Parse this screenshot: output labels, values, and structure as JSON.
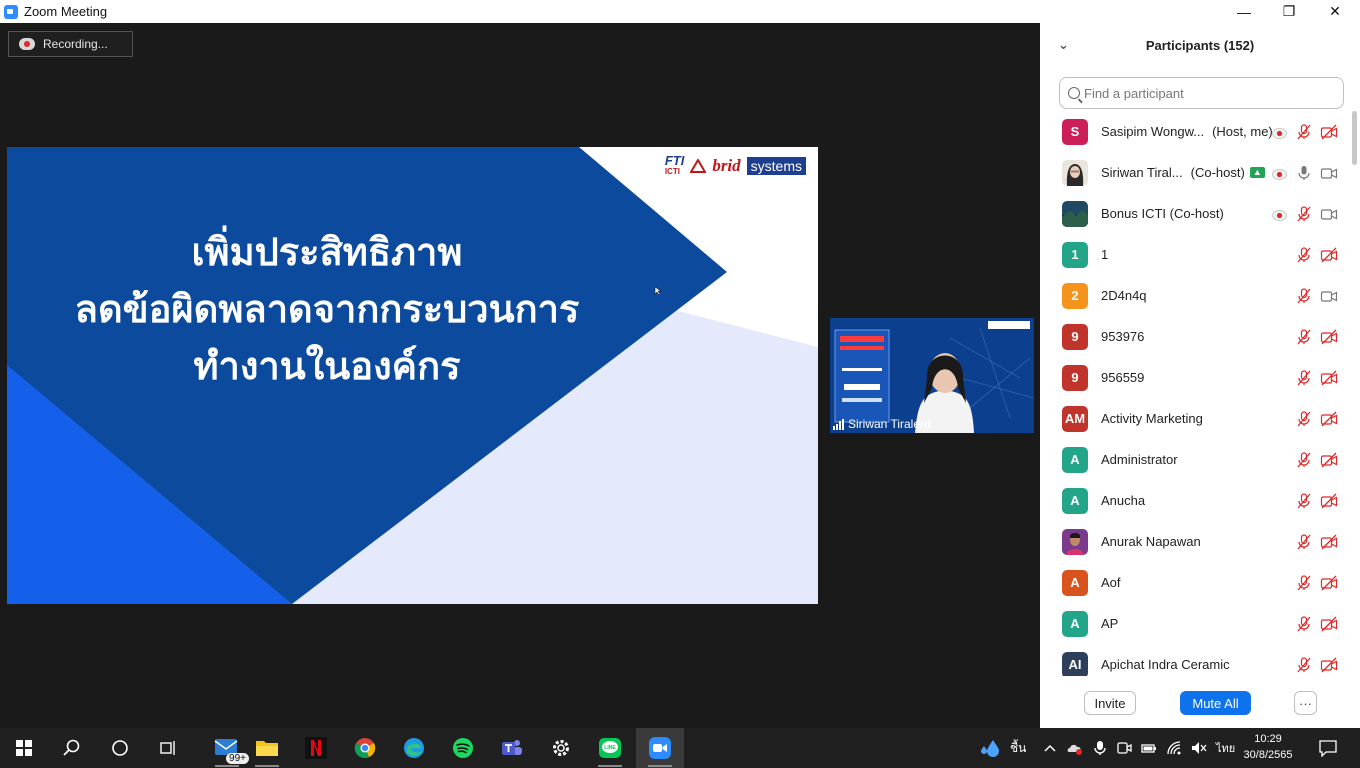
{
  "window": {
    "title": "Zoom Meeting",
    "minimize": "—",
    "maximize": "❐",
    "close": "✕"
  },
  "recording": {
    "label": "Recording..."
  },
  "slide": {
    "lines": [
      "เพิ่มประสิทธิภาพ",
      "ลดข้อผิดพลาดจากกระบวนการ",
      "ทำงานในองค์กร"
    ],
    "logo_fti": "FTI",
    "logo_icti": "ICTI",
    "logo_brid": "brid",
    "logo_systems": "systems",
    "colors": {
      "dark_blue": "#0b4a9c",
      "bright_blue": "#1560ea",
      "light": "#e4eafb"
    }
  },
  "video_thumbnail": {
    "participant_name": "Siriwan Tiralerd"
  },
  "participants_panel": {
    "title": "Participants (152)",
    "search_placeholder": "Find a participant",
    "participants": [
      {
        "initials": "S",
        "avatar_color": "#cc1f5a",
        "name": "Sasipim Wongw...",
        "tag": "(Host, me)",
        "recording": true,
        "raised_hand": false,
        "mic": "muted",
        "camera": "off"
      },
      {
        "initials": "",
        "avatar_type": "photo-woman",
        "name": "Siriwan Tiral...",
        "tag": "(Co-host)",
        "recording": true,
        "raised_hand": true,
        "mic": "on",
        "camera": "on"
      },
      {
        "initials": "",
        "avatar_type": "photo-landscape",
        "name": "Bonus ICTI (Co-host)",
        "tag": "",
        "recording": true,
        "raised_hand": false,
        "mic": "muted",
        "camera": "on"
      },
      {
        "initials": "1",
        "avatar_color": "#23a58a",
        "name": "1",
        "tag": "",
        "recording": false,
        "raised_hand": false,
        "mic": "muted",
        "camera": "off"
      },
      {
        "initials": "2",
        "avatar_color": "#f5941d",
        "name": "2D4n4q",
        "tag": "",
        "recording": false,
        "raised_hand": false,
        "mic": "muted",
        "camera": "on"
      },
      {
        "initials": "9",
        "avatar_color": "#c1342b",
        "name": "953976",
        "tag": "",
        "recording": false,
        "raised_hand": false,
        "mic": "muted",
        "camera": "off"
      },
      {
        "initials": "9",
        "avatar_color": "#c1342b",
        "name": "956559",
        "tag": "",
        "recording": false,
        "raised_hand": false,
        "mic": "muted",
        "camera": "off"
      },
      {
        "initials": "AM",
        "avatar_color": "#c1342b",
        "name": "Activity Marketing",
        "tag": "",
        "recording": false,
        "raised_hand": false,
        "mic": "muted",
        "camera": "off"
      },
      {
        "initials": "A",
        "avatar_color": "#23a58a",
        "name": "Administrator",
        "tag": "",
        "recording": false,
        "raised_hand": false,
        "mic": "muted",
        "camera": "off"
      },
      {
        "initials": "A",
        "avatar_color": "#23a58a",
        "name": "Anucha",
        "tag": "",
        "recording": false,
        "raised_hand": false,
        "mic": "muted",
        "camera": "off"
      },
      {
        "initials": "",
        "avatar_type": "photo-man",
        "name": "Anurak Napawan",
        "tag": "",
        "recording": false,
        "raised_hand": false,
        "mic": "muted",
        "camera": "off"
      },
      {
        "initials": "A",
        "avatar_color": "#d9531e",
        "name": "Aof",
        "tag": "",
        "recording": false,
        "raised_hand": false,
        "mic": "muted",
        "camera": "off"
      },
      {
        "initials": "A",
        "avatar_color": "#23a58a",
        "name": "AP",
        "tag": "",
        "recording": false,
        "raised_hand": false,
        "mic": "muted",
        "camera": "off"
      },
      {
        "initials": "AI",
        "avatar_color": "#2e3f5c",
        "name": "Apichat Indra Ceramic",
        "tag": "",
        "recording": false,
        "raised_hand": false,
        "mic": "muted",
        "camera": "off"
      }
    ],
    "buttons": {
      "invite": "Invite",
      "mute_all": "Mute All",
      "more": "···"
    }
  },
  "taskbar": {
    "apps": [
      "start-icon",
      "search-icon",
      "cortana-icon",
      "task-view-icon",
      "mail-icon",
      "file-explorer-icon",
      "netflix-icon",
      "chrome-icon",
      "edge-icon",
      "spotify-icon",
      "teams-icon",
      "settings-icon",
      "line-icon",
      "zoom-icon"
    ],
    "mail_badge": "99+",
    "weather_text": "ชื้น",
    "language": "ไทย",
    "time": "10:29",
    "date": "30/8/2565"
  }
}
